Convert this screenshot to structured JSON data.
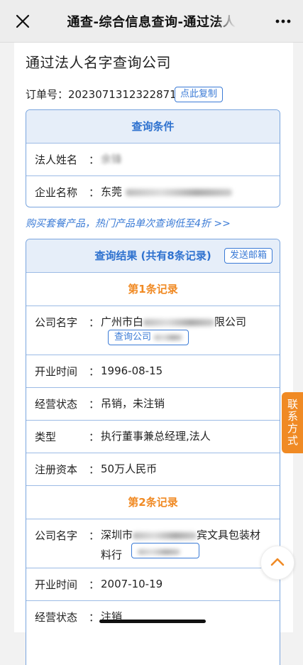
{
  "nav": {
    "title": "通查-综合信息查询-通过法人"
  },
  "page": {
    "title": "通过法人名字查询公司",
    "order_label": "订单号：",
    "order_no": "2023071312322871",
    "copy_label": "点此复制"
  },
  "query": {
    "header": "查询条件",
    "fields": [
      {
        "label": "法人姓名",
        "value": "余锋"
      },
      {
        "label": "企业名称",
        "value": "东莞"
      }
    ]
  },
  "promo": "购买套餐产品，热门产品单次查询低至4折 >>",
  "results": {
    "header": "查询结果 (共有8条记录)",
    "send_label": "发送邮箱",
    "records": [
      {
        "title": "第1条记录",
        "company_label": "公司名字",
        "company_prefix": "广州市白",
        "company_suffix": "限公司",
        "query_btn": "查询公司",
        "fields": [
          {
            "label": "开业时间",
            "value": "1996-08-15"
          },
          {
            "label": "经营状态",
            "value": "吊销，未注销"
          },
          {
            "label": "类型",
            "value": "执行董事兼总经理,法人"
          },
          {
            "label": "注册资本",
            "value": "50万人民币"
          }
        ]
      },
      {
        "title": "第2条记录",
        "company_label": "公司名字",
        "company_prefix": "深圳市",
        "company_suffix": "宾文具包装材",
        "company_line2": "料行",
        "fields": [
          {
            "label": "开业时间",
            "value": "2007-10-19"
          },
          {
            "label": "经营状态",
            "value": "注销"
          }
        ]
      }
    ]
  },
  "contact": "联系方式",
  "colon": "："
}
